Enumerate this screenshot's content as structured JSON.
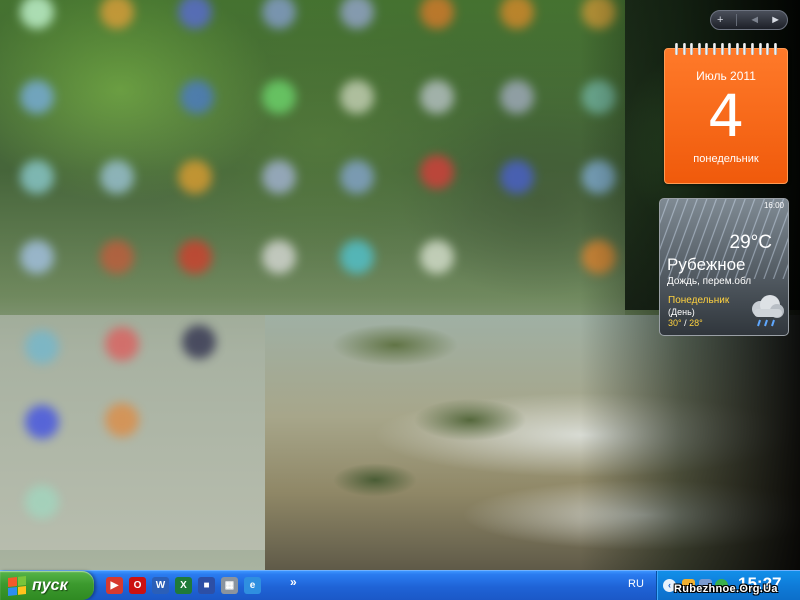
{
  "sidebar": {
    "add_symbol": "+",
    "prev_symbol": "◄",
    "next_symbol": "►"
  },
  "calendar": {
    "month_year": "Июль 2011",
    "day": "4",
    "weekday": "понедельник"
  },
  "weather": {
    "time": "16:00",
    "temperature": "29°C",
    "city": "Рубежное",
    "condition": "Дождь, перем.обл",
    "forecast_day": "Понедельник",
    "forecast_part": "(День)",
    "high": "30°",
    "separator": "/",
    "low": "28°",
    "forecast_icon": "cloud-rain-icon"
  },
  "taskbar": {
    "start_label": "пуск",
    "quick_launch": [
      {
        "icon": "media-player-icon",
        "glyph": "▶",
        "color": "#d73a2f"
      },
      {
        "icon": "opera-icon",
        "glyph": "O",
        "color": "#cc1111"
      },
      {
        "icon": "word-icon",
        "glyph": "W",
        "color": "#2b5fb8"
      },
      {
        "icon": "excel-icon",
        "glyph": "X",
        "color": "#1f7a3a"
      },
      {
        "icon": "save-icon",
        "glyph": "■",
        "color": "#2d4fa6"
      },
      {
        "icon": "calculator-icon",
        "glyph": "▦",
        "color": "#8b949e"
      },
      {
        "icon": "internet-explorer-icon",
        "glyph": "e",
        "color": "#2f8fe0"
      }
    ],
    "more_chevron": "»",
    "language": "RU",
    "tray_expand_symbol": "‹",
    "clock": "15:27"
  },
  "watermark": "Rubezhnoe.Org.Ua",
  "colors": {
    "taskbar_blue": "#1f63d6",
    "start_green": "#3c9a2e",
    "calendar_orange": "#f05a0b",
    "forecast_yellow": "#ffd23f"
  }
}
